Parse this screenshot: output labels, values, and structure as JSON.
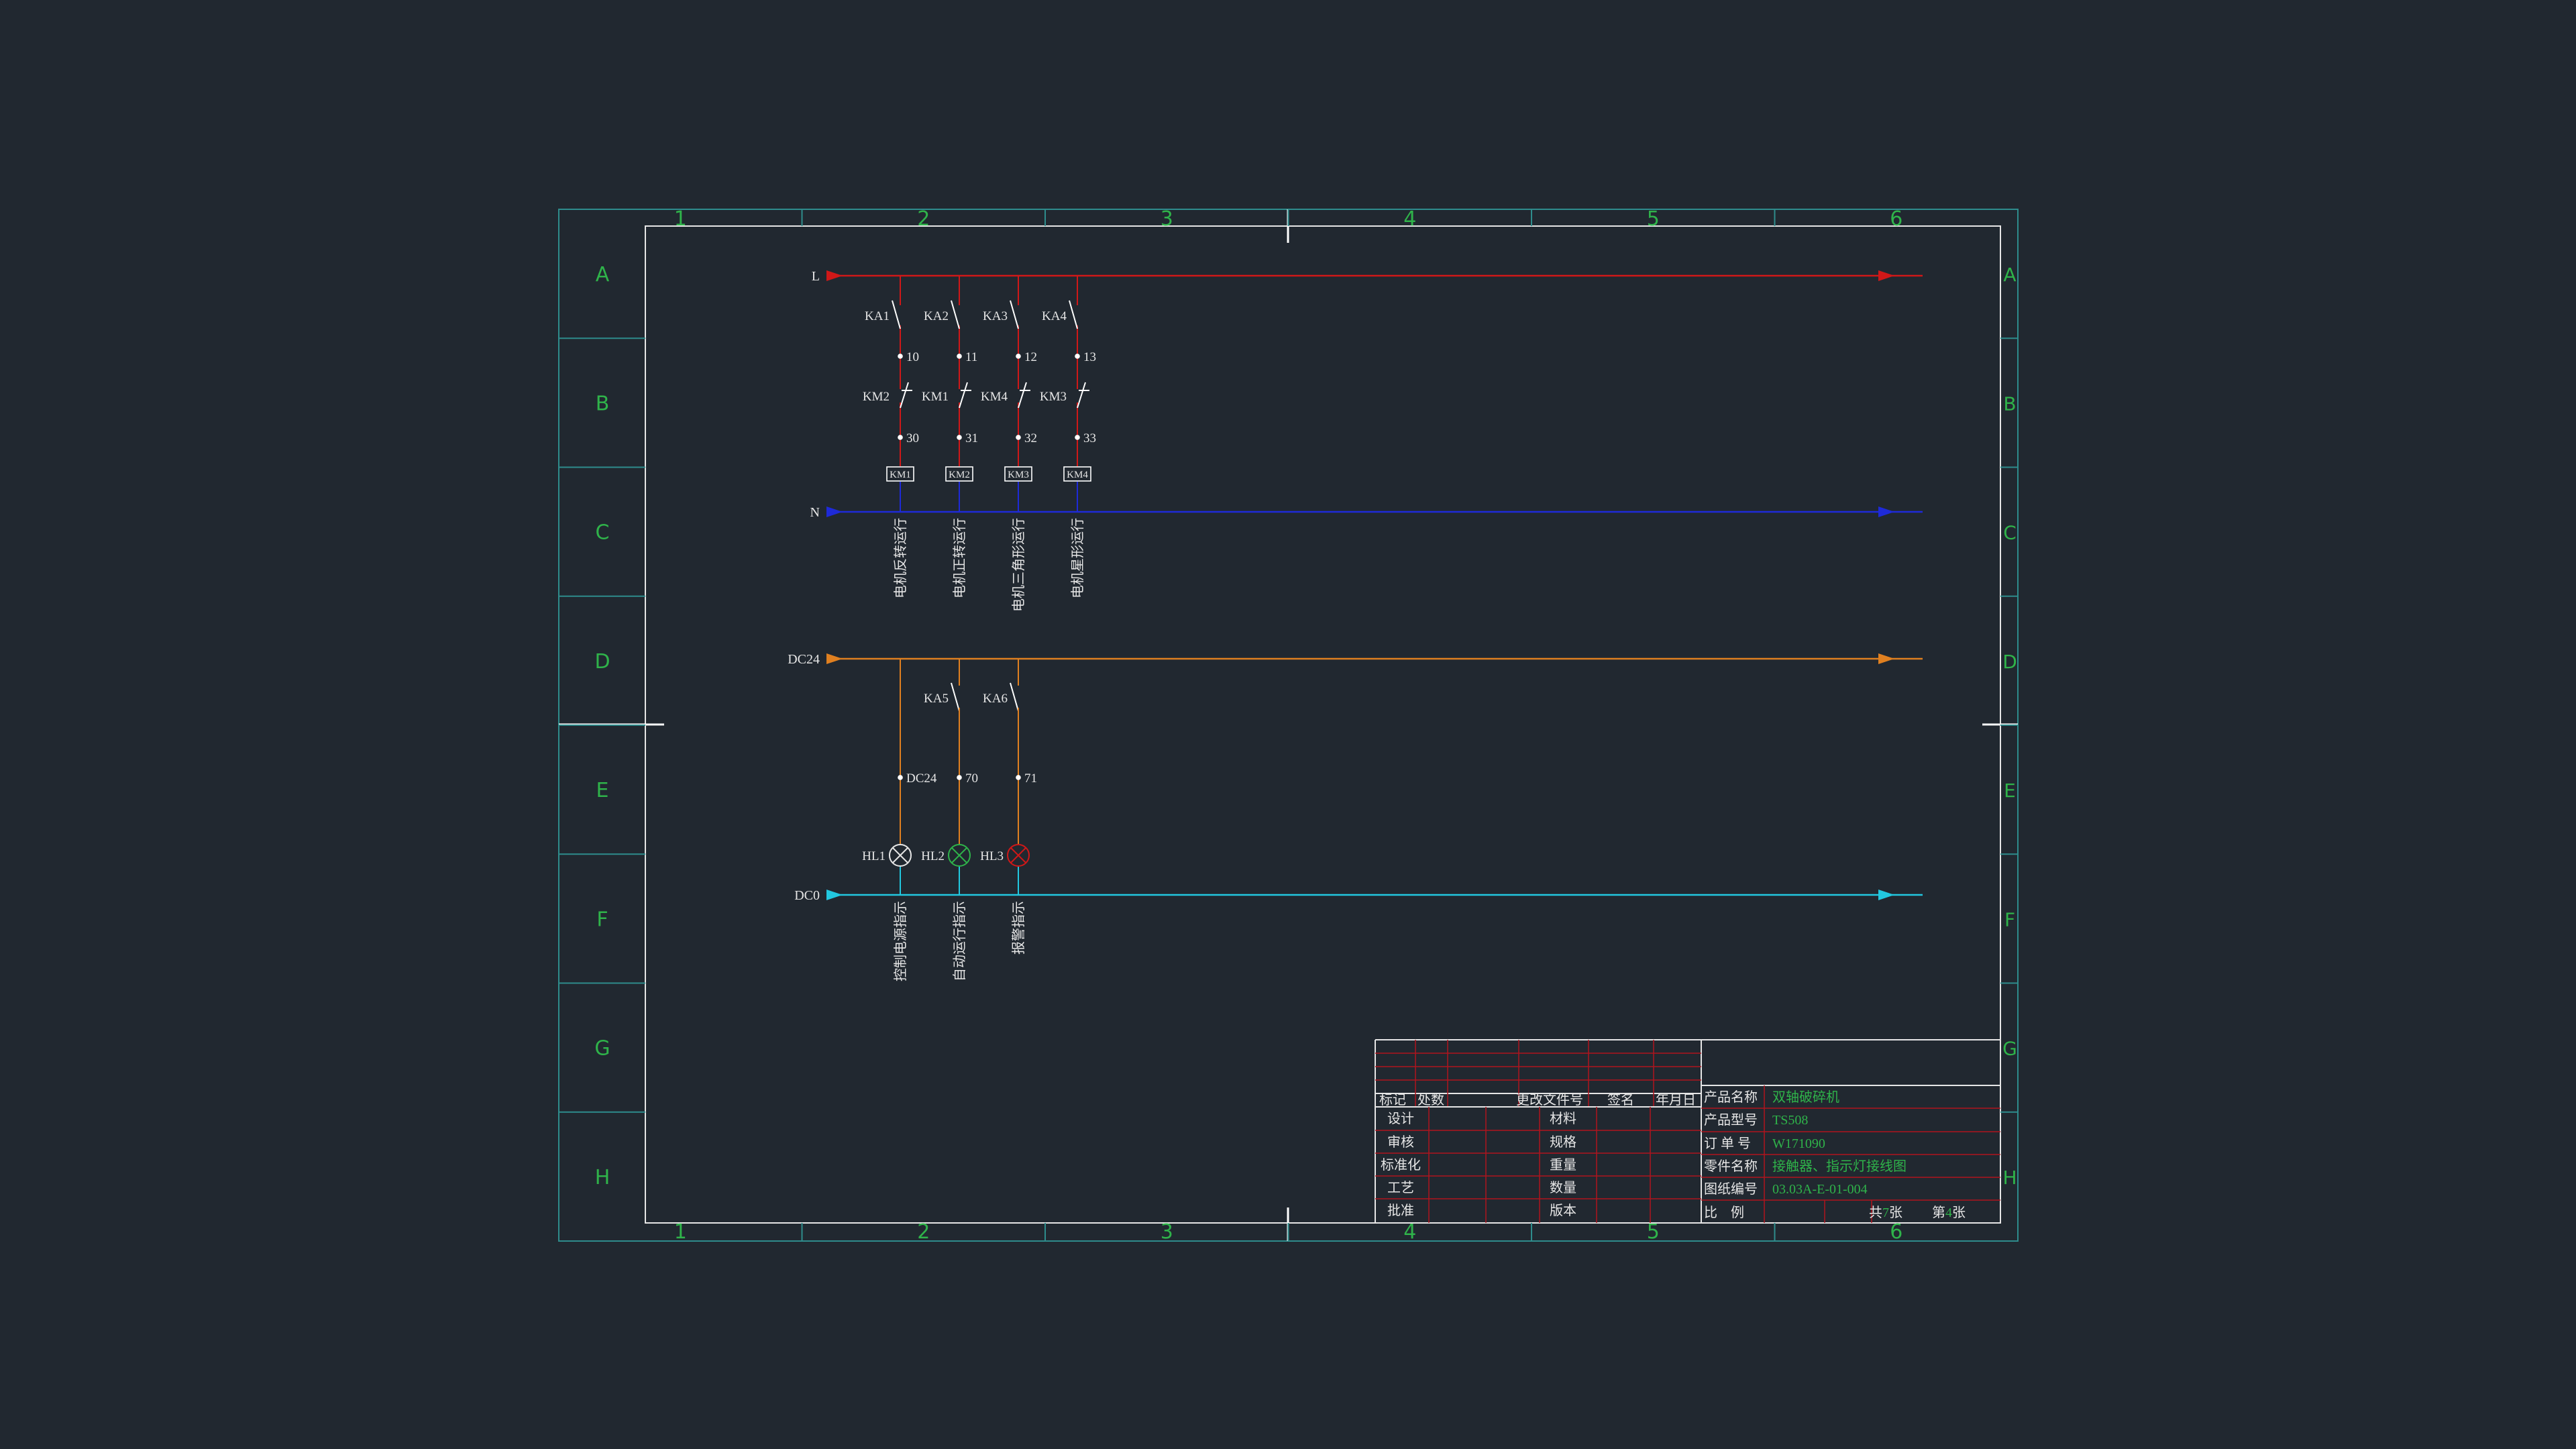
{
  "colors": {
    "background": "#212830",
    "frame": "#2e8c8c",
    "grid_label": "#2fb34a",
    "text": "#e6e6e6",
    "L_bus": "#d01818",
    "N_bus": "#1e2ad8",
    "DC24_bus": "#e08020",
    "DC0_bus": "#22c8e0",
    "title_lines": "#b0141e",
    "title_value": "#2fb34a",
    "lamp_white": "#e6e6e6",
    "lamp_green": "#2fb34a",
    "lamp_red": "#d01818"
  },
  "grid": {
    "columns": [
      "1",
      "2",
      "3",
      "4",
      "5",
      "6"
    ],
    "rows": [
      "A",
      "B",
      "C",
      "D",
      "E",
      "F",
      "G",
      "H"
    ]
  },
  "buses": {
    "L": "L",
    "N": "N",
    "DC24": "DC24",
    "DC0": "DC0"
  },
  "relay_branches": [
    {
      "contact": "KA1",
      "node1": "10",
      "interlock": "KM2",
      "node2": "30",
      "coil": "KM1",
      "desc": "电机反转运行"
    },
    {
      "contact": "KA2",
      "node1": "11",
      "interlock": "KM1",
      "node2": "31",
      "coil": "KM2",
      "desc": "电机正转运行"
    },
    {
      "contact": "KA3",
      "node1": "12",
      "interlock": "KM4",
      "node2": "32",
      "coil": "KM3",
      "desc": "电机三角形运行"
    },
    {
      "contact": "KA4",
      "node1": "13",
      "interlock": "KM3",
      "node2": "33",
      "coil": "KM4",
      "desc": "电机星形运行"
    }
  ],
  "lamp_branches": [
    {
      "contact": "",
      "node": "DC24",
      "lamp": "HL1",
      "lamp_color": "white",
      "desc": "控制电源指示"
    },
    {
      "contact": "KA5",
      "node": "70",
      "lamp": "HL2",
      "lamp_color": "green",
      "desc": "自动运行指示"
    },
    {
      "contact": "KA6",
      "node": "71",
      "lamp": "HL3",
      "lamp_color": "red",
      "desc": "报警指示"
    }
  ],
  "title_block": {
    "revision_headers": [
      "标记",
      "处数",
      "更改文件号",
      "签名",
      "年月日"
    ],
    "left_labels": [
      "设计",
      "审核",
      "标准化",
      "工艺",
      "批准"
    ],
    "mid_labels": [
      "材料",
      "规格",
      "重量",
      "数量",
      "版本"
    ],
    "info": [
      {
        "label": "产品名称",
        "value": "双轴破碎机"
      },
      {
        "label": "产品型号",
        "value": "TS508"
      },
      {
        "label": "订 单 号",
        "value": "W171090"
      },
      {
        "label": "零件名称",
        "value": "接触器、指示灯接线图"
      },
      {
        "label": "图纸编号",
        "value": "03.03A-E-01-004"
      }
    ],
    "scale_label": "比　例",
    "total_prefix": "共",
    "total_value": "7",
    "total_suffix": "张",
    "sheet_prefix": "第",
    "sheet_value": "4",
    "sheet_suffix": "张"
  }
}
